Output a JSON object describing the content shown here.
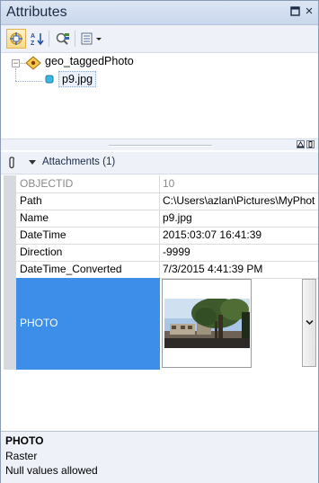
{
  "window": {
    "title": "Attributes",
    "pin_glyph": "□",
    "close_glyph": "×"
  },
  "toolbar": {
    "tools": [
      {
        "name": "selected-features-icon",
        "active": true
      },
      {
        "name": "sort-az-icon",
        "active": false
      },
      {
        "name": "identify-layer-icon",
        "active": false
      },
      {
        "name": "options-menu-icon",
        "active": false
      }
    ]
  },
  "tree": {
    "expander": "−",
    "layer": "geo_taggedPhoto",
    "feature": "p9.jpg"
  },
  "splitter": {
    "collapse_glyph": "⊼",
    "restore_glyph": "▯"
  },
  "attachments": {
    "label": "Attachments (1)"
  },
  "fields": [
    {
      "name": "OBJECTID",
      "value": "10",
      "readonly": true
    },
    {
      "name": "Path",
      "value": "C:\\Users\\azlan\\Pictures\\MyPhot",
      "readonly": false
    },
    {
      "name": "Name",
      "value": "p9.jpg",
      "readonly": false
    },
    {
      "name": "DateTime",
      "value": "2015:03:07 16:41:39",
      "readonly": false
    },
    {
      "name": "Direction",
      "value": "-9999",
      "readonly": false
    },
    {
      "name": "DateTime_Converted",
      "value": "7/3/2015 4:41:39 PM",
      "readonly": false
    }
  ],
  "photo_field": {
    "name": "PHOTO"
  },
  "description": {
    "title": "PHOTO",
    "type": "Raster",
    "nulls": "Null values allowed"
  },
  "colors": {
    "selection": "#3d8ee8",
    "toolbar_bg": "#eef2f8"
  }
}
